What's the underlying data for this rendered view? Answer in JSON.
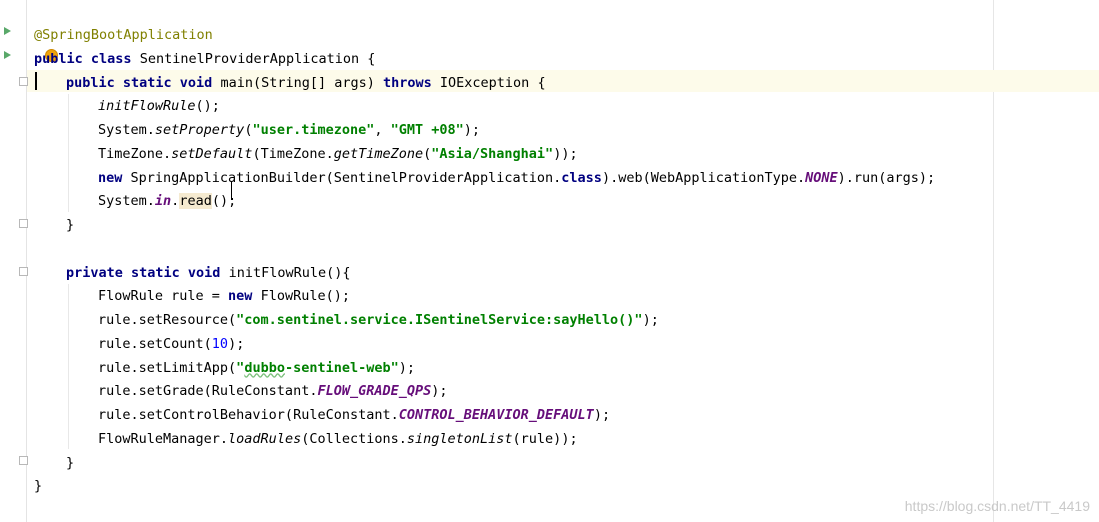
{
  "editor": {
    "lines": {
      "l1": "@SpringBootApplication",
      "l2_kw1": "public",
      "l2_kw2": "class",
      "l2_rest": " SentinelProviderApplication {",
      "l3_kw": "public static void",
      "l3_mid": " main(String[] args) ",
      "l3_kw2": "throws",
      "l3_rest": " IOException {",
      "l4_call": "initFlowRule",
      "l4_rest": "();",
      "l5_a": "System.",
      "l5_m": "setProperty",
      "l5_b": "(",
      "l5_s1": "\"user.timezone\"",
      "l5_c": ", ",
      "l5_s2": "\"GMT +08\"",
      "l5_d": ");",
      "l6_a": "TimeZone.",
      "l6_m1": "setDefault",
      "l6_b": "(TimeZone.",
      "l6_m2": "getTimeZone",
      "l6_c": "(",
      "l6_s": "\"Asia/Shanghai\"",
      "l6_d": "));",
      "l7_kw": "new",
      "l7_a": " SpringApplicationBuilder(SentinelProviderApplication.",
      "l7_kw2": "class",
      "l7_b": ").web(WebApplicationType.",
      "l7_f": "NONE",
      "l7_c": ").run(args);",
      "l8_a": "System.",
      "l8_f": "in",
      "l8_b": ".",
      "l8_m": "read",
      "l8_c": "();",
      "l9": "}",
      "l11_kw": "private static void",
      "l11_rest": " initFlowRule(){",
      "l12_a": "FlowRule rule = ",
      "l12_kw": "new",
      "l12_b": " FlowRule();",
      "l13_a": "rule.setResource(",
      "l13_s": "\"com.sentinel.service.ISentinelService:sayHello()\"",
      "l13_b": ");",
      "l14_a": "rule.setCount(",
      "l14_n": "10",
      "l14_b": ");",
      "l15_a": "rule.setLimitApp(",
      "l15_q1": "\"",
      "l15_s": "dubbo",
      "l15_q2": "-sentinel-web\"",
      "l15_b": ");",
      "l16_a": "rule.setGrade(RuleConstant.",
      "l16_f": "FLOW_GRADE_QPS",
      "l16_b": ");",
      "l17_a": "rule.setControlBehavior(RuleConstant.",
      "l17_f": "CONTROL_BEHAVIOR_DEFAULT",
      "l17_b": ");",
      "l18_a": "FlowRuleManager.",
      "l18_m1": "loadRules",
      "l18_b": "(Collections.",
      "l18_m2": "singletonList",
      "l18_c": "(rule));",
      "l19": "}",
      "l20": "}"
    }
  },
  "colors": {
    "keyword": "#000080",
    "string": "#008000",
    "annotation": "#808000",
    "number": "#0000ff",
    "static_field": "#660e7a",
    "caret_line": "#fdfbea"
  },
  "watermark": "https://blog.csdn.net/TT_4419"
}
